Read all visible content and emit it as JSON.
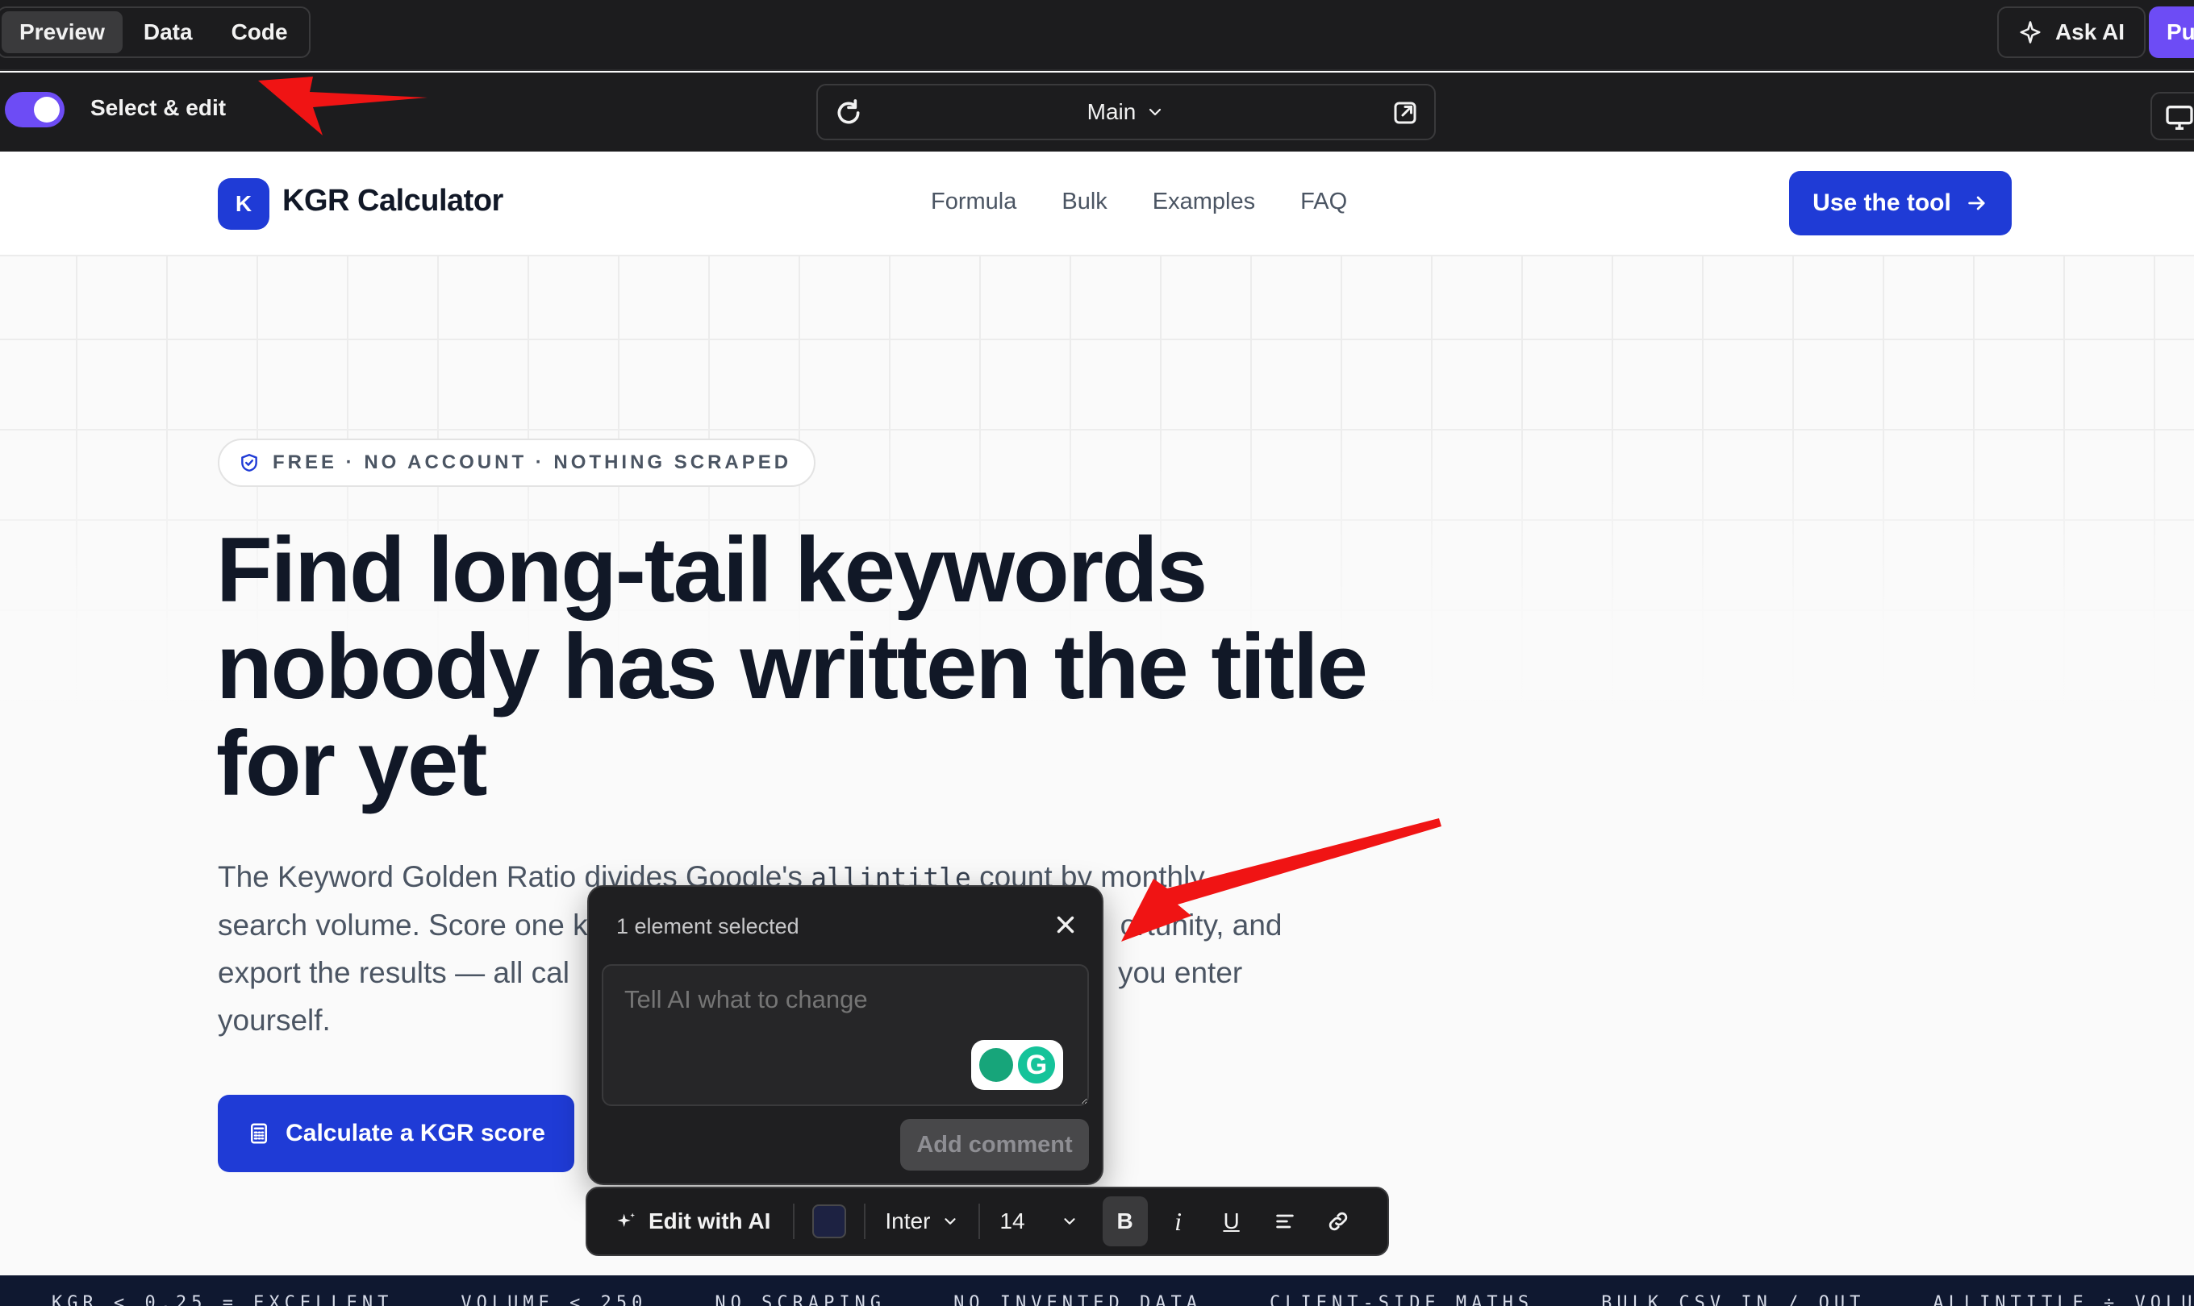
{
  "editor": {
    "view_tabs": [
      "Preview",
      "Data",
      "Code"
    ],
    "active_tab": "Preview",
    "ask_ai_label": "Ask AI",
    "publish_label": "Pu",
    "select_edit_label": "Select & edit",
    "select_edit_on": true,
    "page_selector": "Main"
  },
  "site": {
    "logo_letter": "K",
    "logo_text": "KGR Calculator",
    "nav": [
      "Formula",
      "Bulk",
      "Examples",
      "FAQ"
    ],
    "cta_label": "Use the tool"
  },
  "hero": {
    "badge": "FREE · NO ACCOUNT · NOTHING SCRAPED",
    "headline_line1": "Find long-tail keywords",
    "headline_line2": "nobody has written the title",
    "headline_line3_a": "for",
    "headline_highlight": "yet",
    "lede_line1_a": "The Keyword Golden Ratio divides Google's ",
    "lede_code": "allintitle",
    "lede_line1_b": " count by monthly",
    "lede_line2": "search volume. Score one k",
    "lede_line2_tail": "ortunity, and",
    "lede_line3": "export the results — all cal",
    "lede_line3_tail": "you enter",
    "lede_line4": "yourself.",
    "cta_label": "Calculate a KGR score"
  },
  "ticker": [
    "KGR < 0.25 = EXCELLENT",
    "VOLUME < 250",
    "NO SCRAPING",
    "NO INVENTED DATA",
    "CLIENT-SIDE MATHS",
    "BULK CSV IN / OUT",
    "ALLINTITLE ÷ VOLUME"
  ],
  "comment_popup": {
    "title": "1 element selected",
    "placeholder": "Tell AI what to change",
    "submit_label": "Add comment"
  },
  "format_toolbar": {
    "edit_ai_label": "Edit with AI",
    "color_value": "#1d2242",
    "font": "Inter",
    "size": "14",
    "bold_label": "B",
    "italic_label": "i",
    "underline_label": "U"
  },
  "colors": {
    "brand_blue": "#1f3bd6",
    "accent_purple": "#6d4cf5",
    "annotation_red": "#f01414"
  }
}
